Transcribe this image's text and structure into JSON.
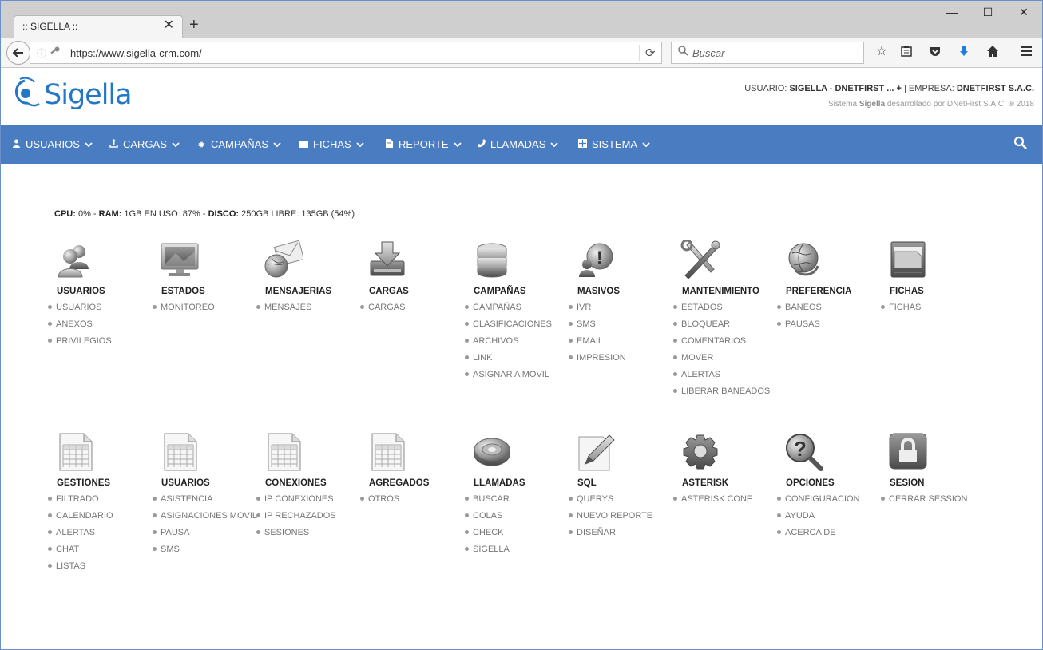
{
  "browser": {
    "tab_title": ":: SIGELLA ::",
    "tab_close": "✕",
    "new_tab": "+",
    "url": "https://www.sigella-crm.com/",
    "search_placeholder": "Buscar",
    "window_controls": {
      "minimize": "—",
      "maximize": "☐",
      "close": "✕"
    }
  },
  "header": {
    "logo_text": "Sigella",
    "user_label": "USUARIO:",
    "user_value": "SIGELLA - DNETFIRST ... +",
    "separator": "|",
    "company_label": "EMPRESA:",
    "company_value": "DNETFIRST S.A.C.",
    "system_prefix": "Sistema",
    "system_name": "Sigella",
    "system_suffix": "desarrollado por DNetFirst S.A.C. ® 2018"
  },
  "menu": [
    {
      "label": "USUARIOS",
      "icon": "user-icon"
    },
    {
      "label": "CARGAS",
      "icon": "upload-icon"
    },
    {
      "label": "CAMPAÑAS",
      "icon": "gear-icon"
    },
    {
      "label": "FICHAS",
      "icon": "folder-icon"
    },
    {
      "label": "REPORTE",
      "icon": "document-icon"
    },
    {
      "label": "LLAMADAS",
      "icon": "phone-icon"
    },
    {
      "label": "SISTEMA",
      "icon": "grid-icon"
    }
  ],
  "stats": {
    "cpu_label": "CPU:",
    "cpu_value": "0% -",
    "ram_label": "RAM:",
    "ram_value": "1GB EN USO: 87% -",
    "disk_label": "DISCO:",
    "disk_value": "250GB LIBRE: 135GB (54%)"
  },
  "modules_row1": [
    {
      "title": "USUARIOS",
      "icon": "users-icon",
      "links": [
        "USUARIOS",
        "ANEXOS",
        "PRIVILEGIOS"
      ]
    },
    {
      "title": "ESTADOS",
      "icon": "monitor-icon",
      "links": [
        "MONITOREO"
      ]
    },
    {
      "title": "MENSAJERIAS",
      "icon": "mail-globe-icon",
      "links": [
        "MENSAJES"
      ]
    },
    {
      "title": "CARGAS",
      "icon": "download-drive-icon",
      "links": [
        "CARGAS"
      ]
    },
    {
      "title": "CAMPAÑAS",
      "icon": "database-icon",
      "links": [
        "CAMPAÑAS",
        "CLASIFICACIONES",
        "ARCHIVOS",
        "LINK",
        "ASIGNAR A MOVIL"
      ]
    },
    {
      "title": "MASIVOS",
      "icon": "alert-user-icon",
      "links": [
        "IVR",
        "SMS",
        "EMAIL",
        "IMPRESION"
      ]
    },
    {
      "title": "MANTENIMIENTO",
      "icon": "tools-icon",
      "links": [
        "ESTADOS",
        "BLOQUEAR",
        "COMENTARIOS",
        "MOVER",
        "ALERTAS",
        "LIBERAR BANEADOS"
      ]
    },
    {
      "title": "PREFERENCIA",
      "icon": "globe-icon",
      "links": [
        "BANEOS",
        "PAUSAS"
      ]
    },
    {
      "title": "FICHAS",
      "icon": "file-cabinet-icon",
      "links": [
        "FICHAS"
      ]
    }
  ],
  "modules_row2": [
    {
      "title": "GESTIONES",
      "icon": "spreadsheet-icon",
      "links": [
        "FILTRADO",
        "CALENDARIO",
        "ALERTAS",
        "CHAT",
        "LISTAS"
      ]
    },
    {
      "title": "USUARIOS",
      "icon": "spreadsheet-icon",
      "links": [
        "ASISTENCIA",
        "ASIGNACIONES MOVIL",
        "PAUSA",
        "SMS"
      ]
    },
    {
      "title": "CONEXIONES",
      "icon": "spreadsheet-icon",
      "links": [
        "IP CONEXIONES",
        "IP RECHAZADOS",
        "SESIONES"
      ]
    },
    {
      "title": "AGREGADOS",
      "icon": "spreadsheet-icon",
      "links": [
        "OTROS"
      ]
    },
    {
      "title": "LLAMADAS",
      "icon": "speaker-icon",
      "links": [
        "BUSCAR",
        "COLAS",
        "CHECK",
        "SIGELLA"
      ]
    },
    {
      "title": "SQL",
      "icon": "pencil-paper-icon",
      "links": [
        "QUERYS",
        "NUEVO REPORTE",
        "DISEÑAR"
      ]
    },
    {
      "title": "ASTERISK",
      "icon": "cog-icon",
      "links": [
        "ASTERISK CONF."
      ]
    },
    {
      "title": "OPCIONES",
      "icon": "help-search-icon",
      "links": [
        "CONFIGURACION",
        "AYUDA",
        "ACERCA DE"
      ]
    },
    {
      "title": "SESION",
      "icon": "lock-icon",
      "links": [
        "CERRAR SESSION"
      ]
    }
  ]
}
